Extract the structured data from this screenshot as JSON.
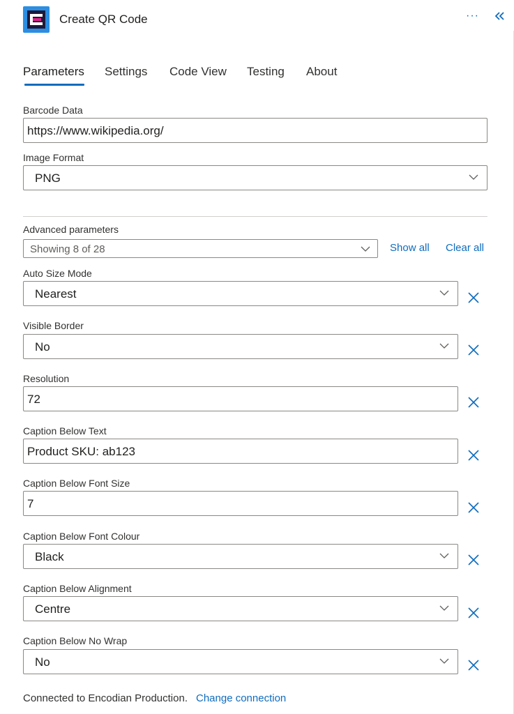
{
  "header": {
    "title": "Create QR Code",
    "more_glyph": "···",
    "accent_color": "#0f6cbd",
    "logo_color": "#2b8ee3"
  },
  "tabs": [
    {
      "label": "Parameters",
      "active": true
    },
    {
      "label": "Settings",
      "active": false
    },
    {
      "label": "Code View",
      "active": false
    },
    {
      "label": "Testing",
      "active": false
    },
    {
      "label": "About",
      "active": false
    }
  ],
  "fields": {
    "barcode_data": {
      "label": "Barcode Data",
      "value": "https://www.wikipedia.org/"
    },
    "image_format": {
      "label": "Image Format",
      "value": "PNG"
    }
  },
  "advanced": {
    "label": "Advanced parameters",
    "summary": "Showing 8 of 28",
    "show_all": "Show all",
    "clear_all": "Clear all"
  },
  "params": [
    {
      "label": "Auto Size Mode",
      "value": "Nearest",
      "kind": "select"
    },
    {
      "label": "Visible Border",
      "value": "No",
      "kind": "select"
    },
    {
      "label": "Resolution",
      "value": "72",
      "kind": "text"
    },
    {
      "label": "Caption Below Text",
      "value": "Product SKU: ab123",
      "kind": "text"
    },
    {
      "label": "Caption Below Font Size",
      "value": "7",
      "kind": "text"
    },
    {
      "label": "Caption Below Font Colour",
      "value": "Black",
      "kind": "select"
    },
    {
      "label": "Caption Below Alignment",
      "value": "Centre",
      "kind": "select"
    },
    {
      "label": "Caption Below No Wrap",
      "value": "No",
      "kind": "select"
    }
  ],
  "footer": {
    "connected_text": "Connected to Encodian Production.",
    "change_link": "Change connection"
  }
}
